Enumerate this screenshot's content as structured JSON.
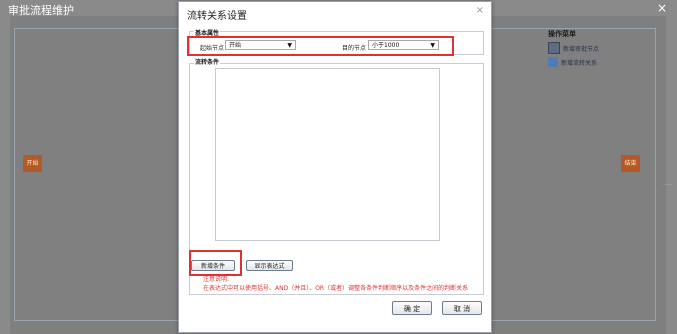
{
  "background": {
    "title": "审批流程维护",
    "close_glyph": "×",
    "start_node": "开始",
    "end_node": "结束",
    "ops_menu": {
      "title": "操作菜单",
      "items": [
        {
          "label": "新增审批节点",
          "icon": "node-add-icon"
        },
        {
          "label": "新增流转关系",
          "icon": "relation-add-icon"
        }
      ]
    },
    "scroll_hint": "·····"
  },
  "dialog": {
    "title": "流转关系设置",
    "close_glyph": "×",
    "basic": {
      "legend": "基本属性",
      "source_label": "起始节点",
      "source_value": "开始",
      "target_label": "目的节点",
      "target_value": "小于1000",
      "dropdown_glyph": "▼"
    },
    "condition": {
      "legend": "流转条件",
      "add_button": "新增条件",
      "show_button": "显示表达式",
      "note_title": "注意说明:",
      "note_body": "在表达式中可以使用括号、AND（并且）、OR（或者）调整各条件判断顺序以及条件之间的判断关系"
    },
    "ok_button": "确 定",
    "cancel_button": "取 消"
  },
  "colors": {
    "highlight": "#e03131",
    "node_fill": "#b35a28",
    "overlay": "#8a8a8a"
  }
}
